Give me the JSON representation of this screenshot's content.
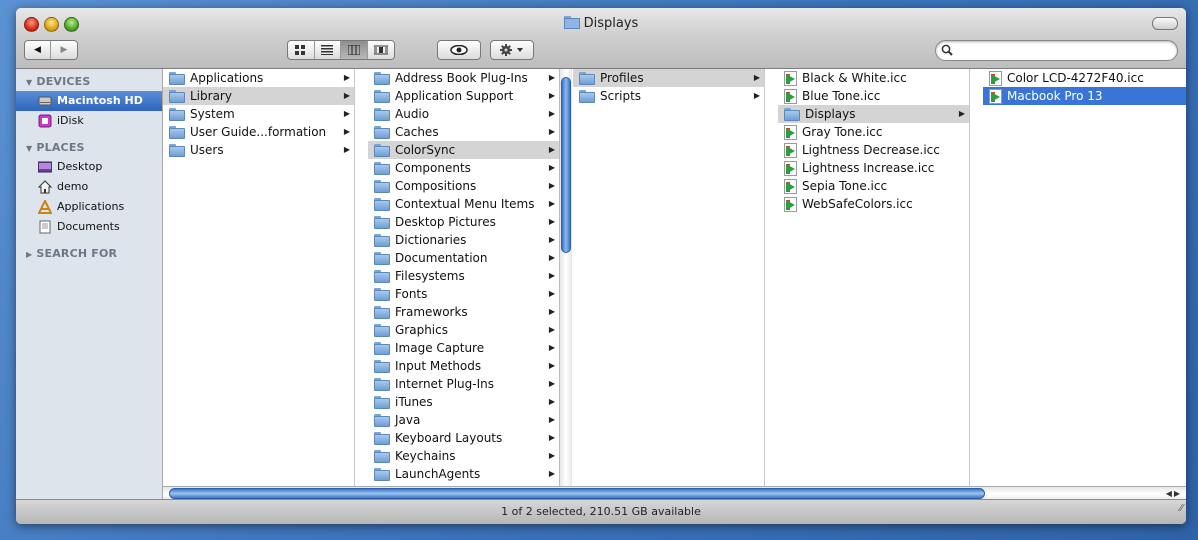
{
  "window": {
    "title": "Displays"
  },
  "toolbar": {
    "back_label": "◀",
    "forward_label": "▶",
    "view_modes": [
      "icon",
      "list",
      "column",
      "coverflow"
    ],
    "active_view": "column",
    "search_placeholder": ""
  },
  "sidebar": {
    "devices_heading": "DEVICES",
    "devices": [
      {
        "label": "Macintosh HD",
        "icon": "hard-drive-icon",
        "selected": true
      },
      {
        "label": "iDisk",
        "icon": "idisk-icon",
        "selected": false
      }
    ],
    "places_heading": "PLACES",
    "places": [
      {
        "label": "Desktop",
        "icon": "desktop-icon"
      },
      {
        "label": "demo",
        "icon": "home-icon"
      },
      {
        "label": "Applications",
        "icon": "applications-icon"
      },
      {
        "label": "Documents",
        "icon": "documents-icon"
      }
    ],
    "search_heading": "SEARCH FOR"
  },
  "columns": [
    {
      "items": [
        "Applications",
        "Library",
        "System",
        "User Guide...formation",
        "Users"
      ],
      "selected": 1,
      "selected_style": "grey"
    },
    {
      "items": [
        "Address Book Plug-Ins",
        "Application Support",
        "Audio",
        "Caches",
        "ColorSync",
        "Components",
        "Compositions",
        "Contextual Menu Items",
        "Desktop Pictures",
        "Dictionaries",
        "Documentation",
        "Filesystems",
        "Fonts",
        "Frameworks",
        "Graphics",
        "Image Capture",
        "Input Methods",
        "Internet Plug-Ins",
        "iTunes",
        "Java",
        "Keyboard Layouts",
        "Keychains",
        "LaunchAgents"
      ],
      "selected": 4,
      "selected_style": "grey"
    },
    {
      "items": [
        "Profiles",
        "Scripts"
      ],
      "selected": 0,
      "selected_style": "grey"
    },
    {
      "items": [
        "Black & White.icc",
        "Blue Tone.icc",
        "Displays",
        "Gray Tone.icc",
        "Lightness Decrease.icc",
        "Lightness Increase.icc",
        "Sepia Tone.icc",
        "WebSafeColors.icc"
      ],
      "selected": 2,
      "selected_style": "grey"
    },
    {
      "items": [
        "Color LCD-4272F40.icc",
        "Macbook Pro 13"
      ],
      "selected": 1,
      "selected_style": "blue"
    }
  ],
  "status": {
    "text": "1 of 2 selected, 210.51 GB available"
  },
  "colors": {
    "selection_blue": "#3875d7",
    "sidebar_bg": "#dde4ec"
  }
}
